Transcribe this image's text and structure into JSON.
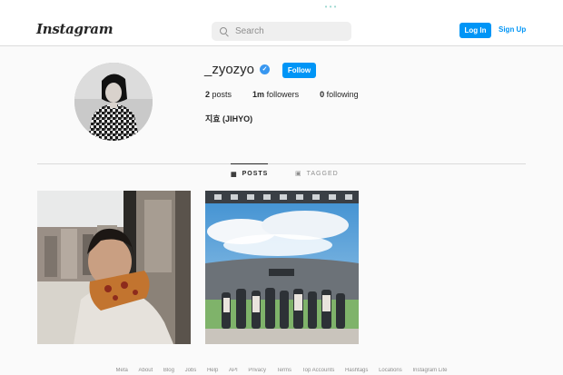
{
  "header": {
    "logo": "Instagram",
    "search_placeholder": "Search",
    "login_label": "Log In",
    "signup_label": "Sign Up"
  },
  "profile": {
    "username": "_zyozyo",
    "verified": true,
    "follow_label": "Follow",
    "posts_count": "2",
    "posts_label": "posts",
    "followers_count": "1m",
    "followers_label": "followers",
    "following_count": "0",
    "following_label": "following",
    "full_name": "지효 (JIHYO)"
  },
  "tabs": [
    {
      "label": "POSTS",
      "icon": "grid-icon",
      "active": true
    },
    {
      "label": "TAGGED",
      "icon": "tag-icon",
      "active": false
    }
  ],
  "footer": {
    "links": [
      "Meta",
      "About",
      "Blog",
      "Jobs",
      "Help",
      "API",
      "Privacy",
      "Terms",
      "Top Accounts",
      "Hashtags",
      "Locations",
      "Instagram Lite"
    ]
  },
  "colors": {
    "accent": "#0095f6",
    "verified": "#3897f0",
    "background": "#fafafa"
  }
}
